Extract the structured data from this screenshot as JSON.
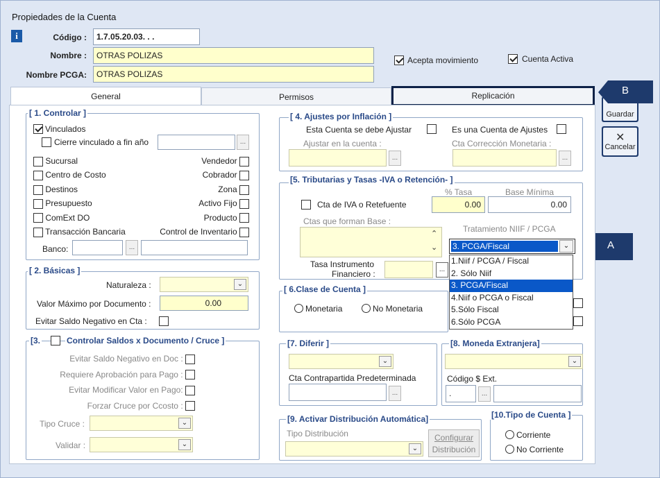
{
  "window": {
    "title": "Propiedades de la Cuenta"
  },
  "header": {
    "codigo_label": "Código :",
    "codigo_value": "1.7.05.20.03. . .",
    "nombre_label": "Nombre :",
    "nombre_value": "OTRAS POLIZAS",
    "pcga_label": "Nombre PCGA:",
    "pcga_value": "OTRAS POLIZAS",
    "acepta_label": "Acepta movimiento",
    "activa_label": "Cuenta Activa"
  },
  "tabs": [
    "General",
    "Permisos",
    "Replicación"
  ],
  "buttons": {
    "guardar": "Guardar",
    "cancelar": "Cancelar"
  },
  "callouts": {
    "a": "A",
    "b": "B"
  },
  "controlar": {
    "title": "[ 1. Controlar ]",
    "vinculados": "Vinculados",
    "cierre": "Cierre vinculado a fin año",
    "left": [
      "Sucursal",
      "Centro de Costo",
      "Destinos",
      "Presupuesto",
      "ComExt DO",
      "Transacción Bancaria"
    ],
    "right": [
      "Vendedor",
      "Cobrador",
      "Zona",
      "Activo Fijo",
      "Producto",
      "Control de Inventario"
    ],
    "banco": "Banco:"
  },
  "basicas": {
    "title": "[ 2. Básicas ]",
    "naturaleza": "Naturaleza :",
    "valor_max": "Valor Máximo por Documento :",
    "valor_max_val": "0.00",
    "evitar": "Evitar Saldo Negativo en Cta :"
  },
  "saldos": {
    "title": "Controlar Saldos x Documento / Cruce ]",
    "prefix": "[3.",
    "items": [
      "Evitar Saldo Negativo en Doc :",
      "Requiere Aprobación para Pago :",
      "Evitar Modificar Valor en Pago:",
      "Forzar Cruce por Ccosto :"
    ],
    "tipo_cruce": "Tipo Cruce :",
    "validar": "Validar :"
  },
  "ajustes": {
    "title": "[ 4. Ajustes por Inflación ]",
    "debe": "Esta Cuenta  se debe Ajustar",
    "es_cuenta": "Es una Cuenta de Ajustes",
    "ajustar_en": "Ajustar en la cuenta :",
    "cta_corr": "Cta Corrección Monetaria :"
  },
  "tributarias": {
    "title": "[5. Tributarias y Tasas  -IVA o Retención- ]",
    "pct_tasa": "% Tasa",
    "base_min": "Base Mínima",
    "cta_iva": "Cta de IVA o Retefuente",
    "tasa_val": "0.00",
    "base_val": "0.00",
    "ctas_base": "Ctas que forman Base :",
    "tratamiento": "Tratamiento NIIF / PCGA",
    "selected": "3. PCGA/Fiscal",
    "options": [
      "1.Niif / PCGA / Fiscal",
      "2. Sólo Niif",
      "3. PCGA/Fiscal",
      "4.Niif o PCGA o Fiscal",
      "5.Sólo Fiscal",
      "6.Sólo PCGA"
    ],
    "tasa_instr": "Tasa Instrumento",
    "financiero": "Financiero :"
  },
  "clase": {
    "title": "[ 6.Clase de Cuenta ]",
    "monetaria": "Monetaria",
    "no_monetaria": "No Monetaria"
  },
  "diferir": {
    "title": "[7. Diferir ]",
    "contra": "Cta Contrapartida Predeterminada"
  },
  "moneda": {
    "title": "[8. Moneda Extranjera]",
    "codigo": "Código $ Ext.",
    "dot": "."
  },
  "distribucion": {
    "title": "[9. Activar Distribución Automática]",
    "tipo": "Tipo Distribución",
    "configurar": "Configurar",
    "distrib": "Distribución"
  },
  "tipo_cuenta": {
    "title": "[10.Tipo de Cuenta ]",
    "corriente": "Corriente",
    "no_corriente": "No Corriente"
  }
}
